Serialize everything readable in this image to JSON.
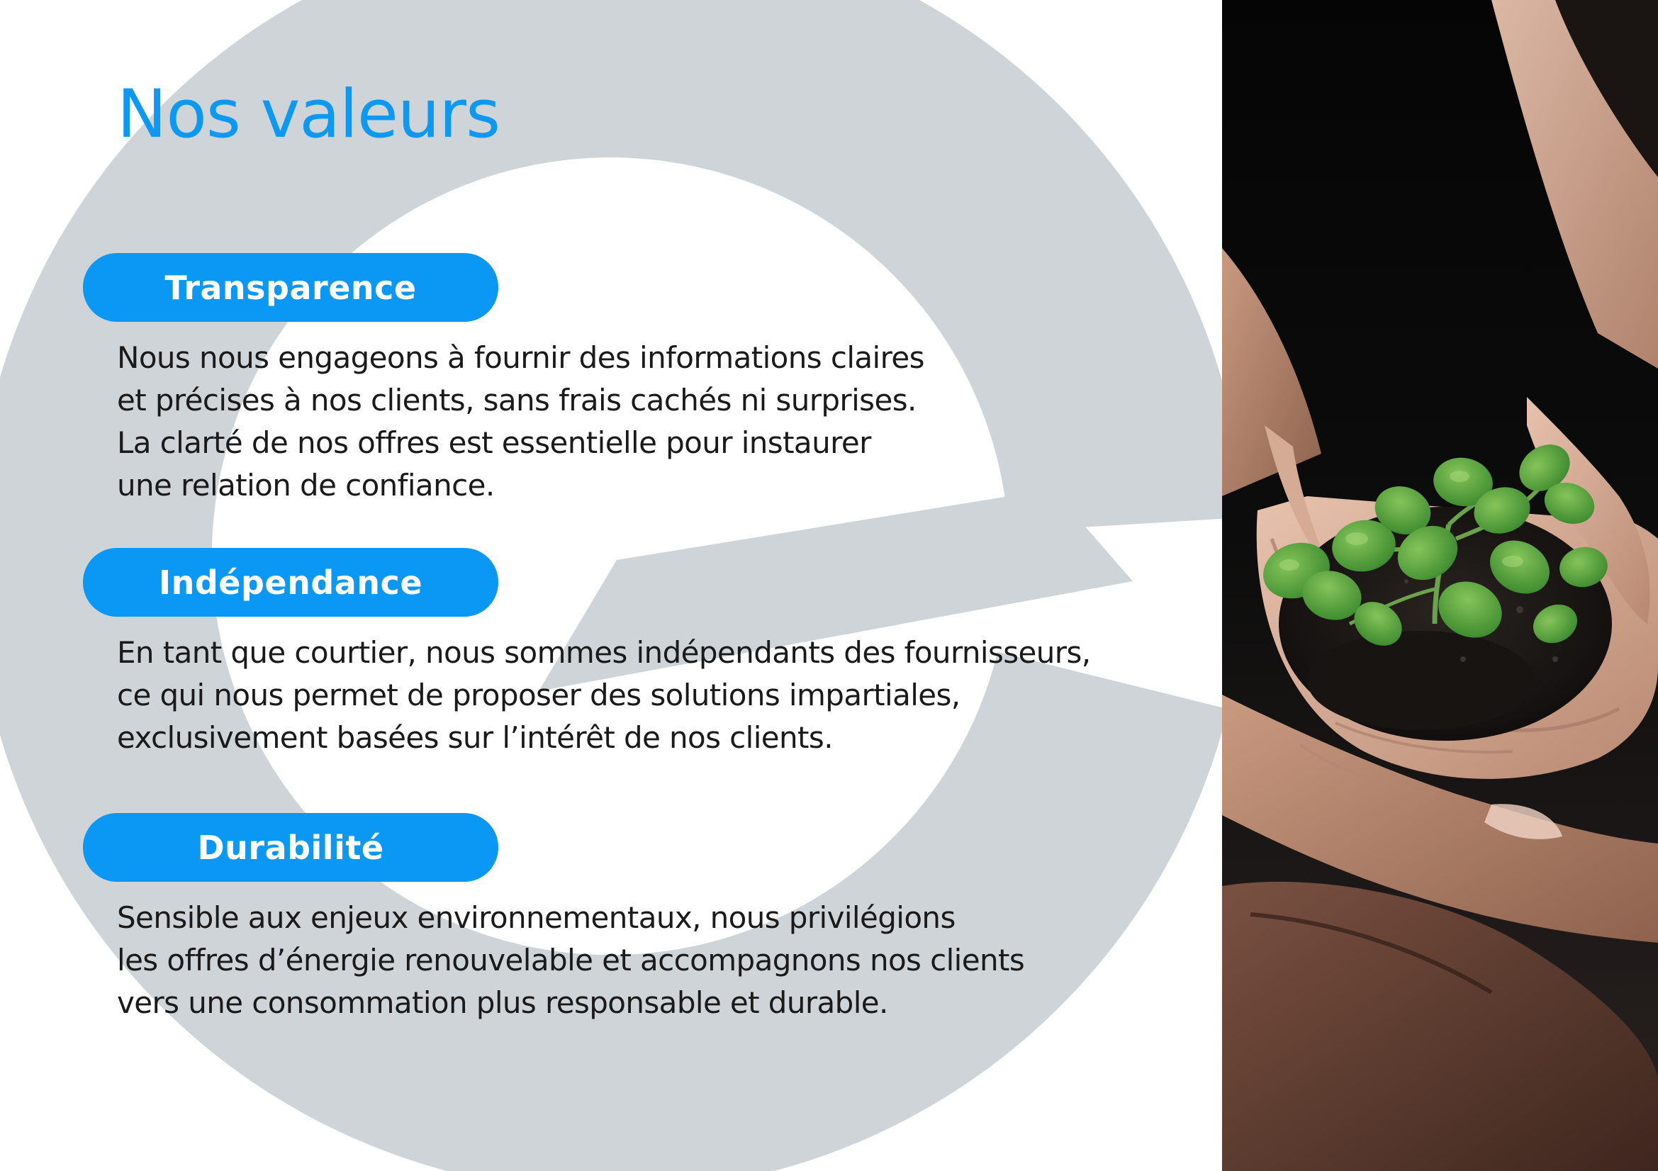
{
  "page": {
    "title": "Nos valeurs"
  },
  "values": [
    {
      "label": "Transparence",
      "text": "Nous nous engageons à fournir des informations claires\net précises à nos clients, sans frais cachés ni surprises.\nLa clarté de nos offres est essentielle pour instaurer\nune relation de confiance."
    },
    {
      "label": "Indépendance",
      "text": "En tant que courtier, nous sommes indépendants des fournisseurs,\nce qui nous permet de proposer des solutions impartiales,\nexclusivement basées sur l’intérêt de nos clients."
    },
    {
      "label": "Durabilité",
      "text": "Sensible aux enjeux environnementaux, nous privilégions\nles offres d’énergie renouvelable et accompagnons nos clients\nvers une consommation plus responsable et durable."
    }
  ],
  "colors": {
    "accent": "#0b98f5",
    "title": "#0d99f2",
    "watermark": "#cfd4d8",
    "body_text": "#1a1a1a"
  },
  "icons": {
    "watermark": "brand-e-logo-icon",
    "photo": "hands-holding-seedling-photo"
  }
}
